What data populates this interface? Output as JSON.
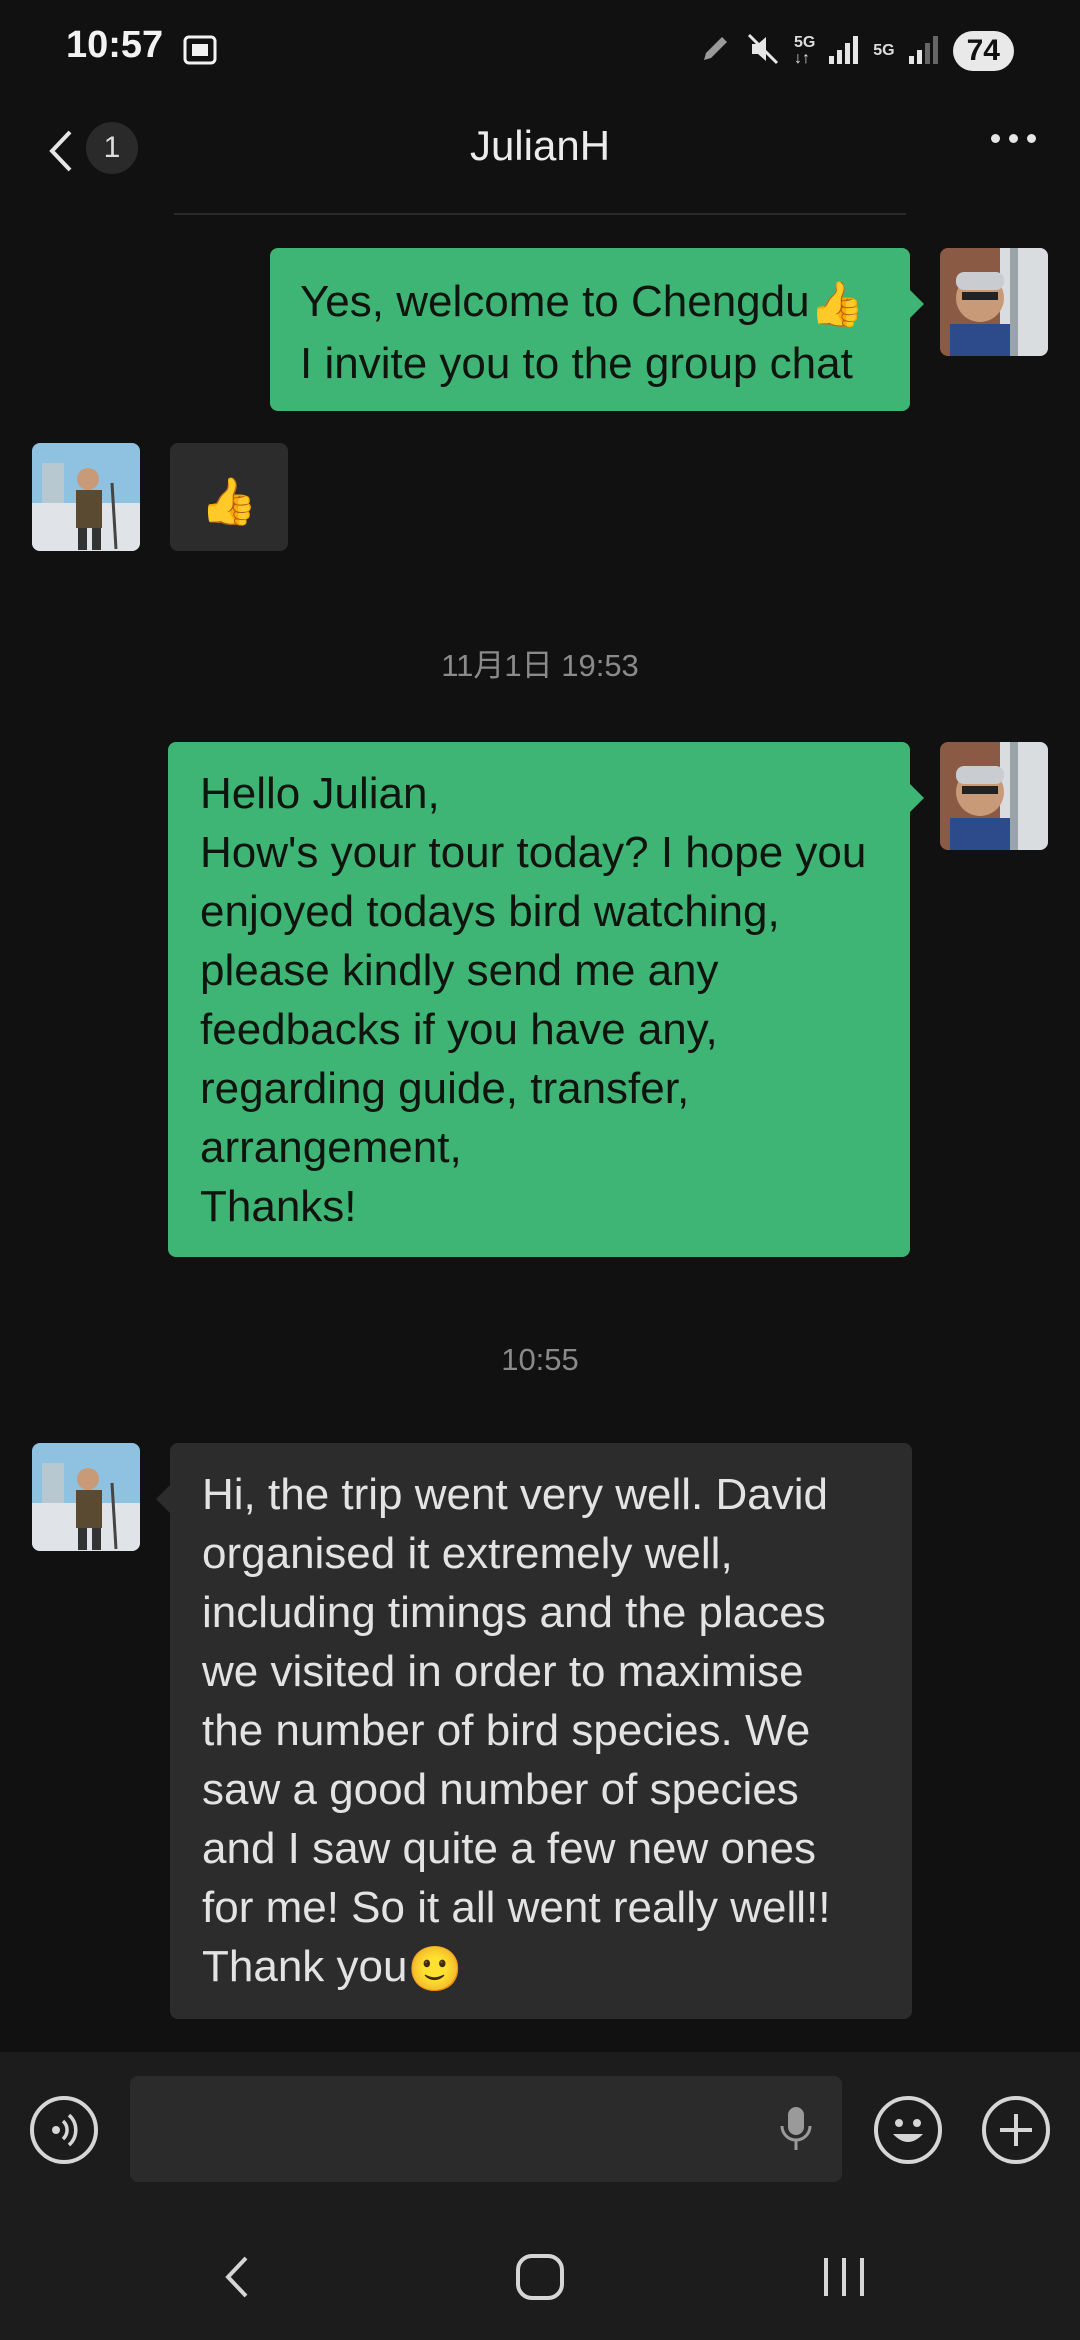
{
  "status_bar": {
    "time": "10:57",
    "network_1": "5G",
    "network_2": "5G",
    "battery": "74"
  },
  "header": {
    "unread_count": "1",
    "title": "JulianH",
    "back_icon": "chevron-left-icon",
    "more_icon": "more-horizontal-icon"
  },
  "messages": [
    {
      "sender": "me",
      "lines": [
        "Yes, welcome to Chengdu",
        "I invite you to the group chat"
      ],
      "emoji": "👍"
    },
    {
      "sender": "JulianH",
      "emoji": "👍"
    },
    {
      "timestamp": "11月1日 19:53"
    },
    {
      "sender": "me",
      "lines": [
        "Hello Julian,",
        "How's your tour today? I hope you",
        "enjoyed todays bird watching,",
        "please kindly send me any",
        "feedbacks if you have any,",
        "regarding guide, transfer,",
        "arrangement,",
        "Thanks!"
      ]
    },
    {
      "timestamp": "10:55"
    },
    {
      "sender": "JulianH",
      "lines": [
        "Hi, the trip went very well. David",
        "organised it extremely well,",
        "including timings and the places",
        "we visited in order to maximise",
        "the number of bird species. We",
        "saw a good number of species",
        "and I saw quite a few new ones",
        "for me! So it all went really well!!",
        "Thank you"
      ],
      "emoji": "🙂"
    }
  ],
  "input_bar": {
    "voice_icon": "voice-mode-icon",
    "mic_icon": "microphone-icon",
    "emoji_icon": "emoji-smile-icon",
    "plus_icon": "plus-icon"
  },
  "colors": {
    "background": "#111111",
    "my_bubble": "#3eb575",
    "their_bubble": "#2c2c2c"
  }
}
